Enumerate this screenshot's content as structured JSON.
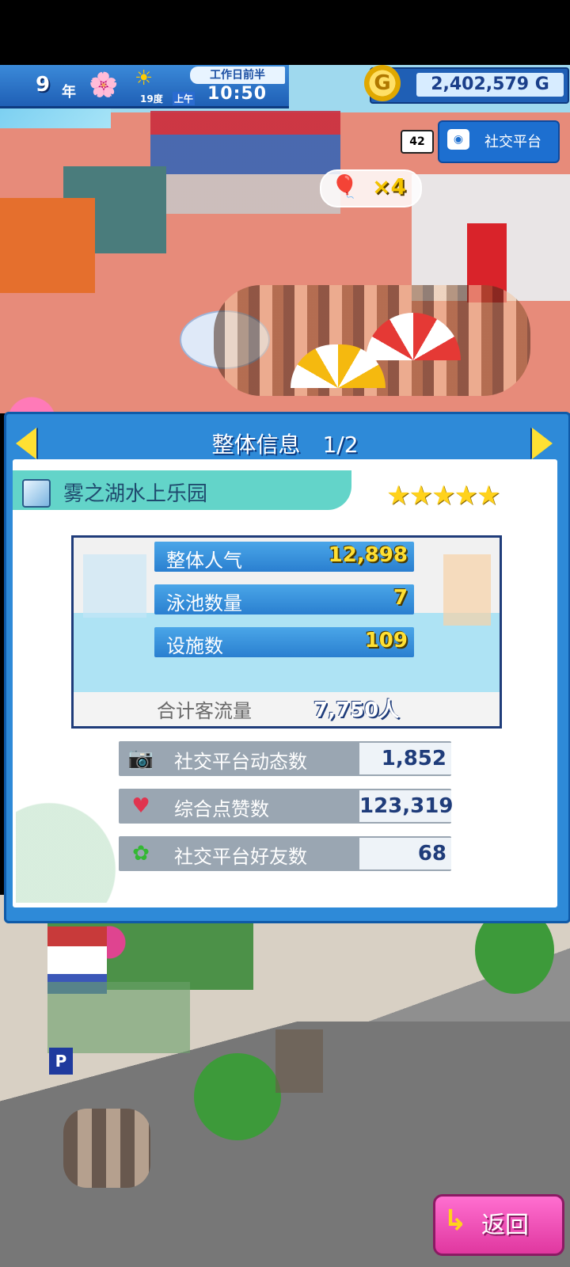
{
  "hud": {
    "year_number": "9",
    "year_label": "年",
    "temperature": "19度",
    "ampm": "上午",
    "time": "10:50",
    "period": "工作日前半",
    "gold": "2,402,579 G",
    "friend_count": "42",
    "sns_button_label": "社交平台",
    "combo_text": "×4"
  },
  "panel": {
    "title": "整体信息　1/2",
    "park_name": "雾之湖水上乐园",
    "rating_stars": 5,
    "stars_display": "★★★★★",
    "stats": [
      {
        "label": "整体人气",
        "value": "12,898"
      },
      {
        "label": "泳池数量",
        "value": "7"
      },
      {
        "label": "设施数",
        "value": "109"
      }
    ],
    "total_visitors_label": "合计客流量",
    "total_visitors_value": "7,750人",
    "sns_stats": [
      {
        "label": "社交平台动态数",
        "value": "1,852",
        "icon": "camera-icon"
      },
      {
        "label": "综合点赞数",
        "value": "123,319",
        "icon": "heart-icon"
      },
      {
        "label": "社交平台好友数",
        "value": "68",
        "icon": "friends-icon"
      }
    ]
  },
  "back_button_label": "返回",
  "colors": {
    "panel_blue": "#2e8ad8",
    "accent_yellow": "#ffe033",
    "back_pink": "#e0379f",
    "banner_teal": "#63d4c9"
  }
}
